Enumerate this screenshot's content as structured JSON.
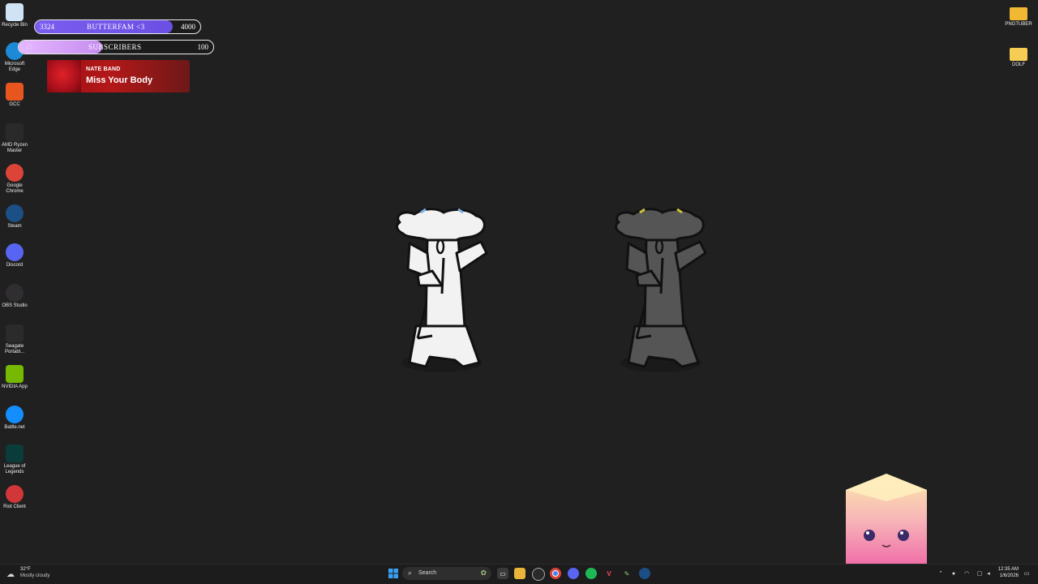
{
  "desktop_left_icons": [
    {
      "name": "recycle-bin",
      "label": "Recycle Bin",
      "icon": "recycle-bin-icon",
      "color": "#cfe3f5"
    },
    {
      "name": "microsoft-edge",
      "label": "Microsoft Edge",
      "icon": "edge-icon",
      "color": "#1c8ad6"
    },
    {
      "name": "gcc",
      "label": "GCC",
      "icon": "gcc-icon",
      "color": "#e8561f"
    },
    {
      "name": "amd-ryzen-master",
      "label": "AMD Ryzen Master",
      "icon": "ryzen-master-icon",
      "color": "#2a2a2a"
    },
    {
      "name": "google-chrome",
      "label": "Google Chrome",
      "icon": "chrome-icon",
      "color": "#db4437"
    },
    {
      "name": "steam",
      "label": "Steam",
      "icon": "steam-icon",
      "color": "#1b4f85"
    },
    {
      "name": "discord",
      "label": "Discord",
      "icon": "discord-icon",
      "color": "#5865f2"
    },
    {
      "name": "obs-studio",
      "label": "OBS Studio",
      "icon": "obs-icon",
      "color": "#302e31"
    },
    {
      "name": "seagate-portable",
      "label": "Seagate Portabl...",
      "icon": "drive-icon",
      "color": "#2b2b2b"
    },
    {
      "name": "nvidia-app",
      "label": "NVIDIA App",
      "icon": "nvidia-icon",
      "color": "#76b900"
    },
    {
      "name": "battle-net",
      "label": "Battle.net",
      "icon": "battlenet-icon",
      "color": "#148eff"
    },
    {
      "name": "league-of-legends",
      "label": "League of Legends",
      "icon": "league-icon",
      "color": "#0a3c3a"
    },
    {
      "name": "riot-client",
      "label": "Riot Client",
      "icon": "riot-icon",
      "color": "#d13639"
    }
  ],
  "desktop_right_icons": [
    {
      "name": "pngtuber-folder",
      "label": "PNGTUBER",
      "icon": "folder-icon",
      "color": "#f0b833"
    },
    {
      "name": "dolf-folder",
      "label": "DOLF",
      "icon": "folder-icon",
      "color": "#f5cd55"
    }
  ],
  "overlay": {
    "follower_goal": {
      "current": "3324",
      "label": "BUTTERFAM <3",
      "target": "4000",
      "progress": 0.831,
      "fill_color": "#6b4fe3"
    },
    "sub_goal": {
      "current": "43",
      "label": "SUBSCRIBERS",
      "target": "100",
      "progress": 0.43,
      "fill_color": "#c48df0"
    },
    "now_playing": {
      "artist": "NATE BAND",
      "title": "Miss Your Body",
      "color": "#b31818"
    }
  },
  "taskbar": {
    "weather": {
      "temp": "32°F",
      "condition": "Mostly cloudy"
    },
    "search_placeholder": "Search",
    "apps": [
      "start-icon",
      "task-view-icon",
      "file-explorer-icon",
      "obs-icon",
      "chrome-icon",
      "discord-icon",
      "spotify-icon",
      "valorant-icon",
      "pen-app-icon",
      "steam-icon"
    ],
    "clock": {
      "time": "12:35 AM",
      "date": "1/6/2026"
    }
  }
}
